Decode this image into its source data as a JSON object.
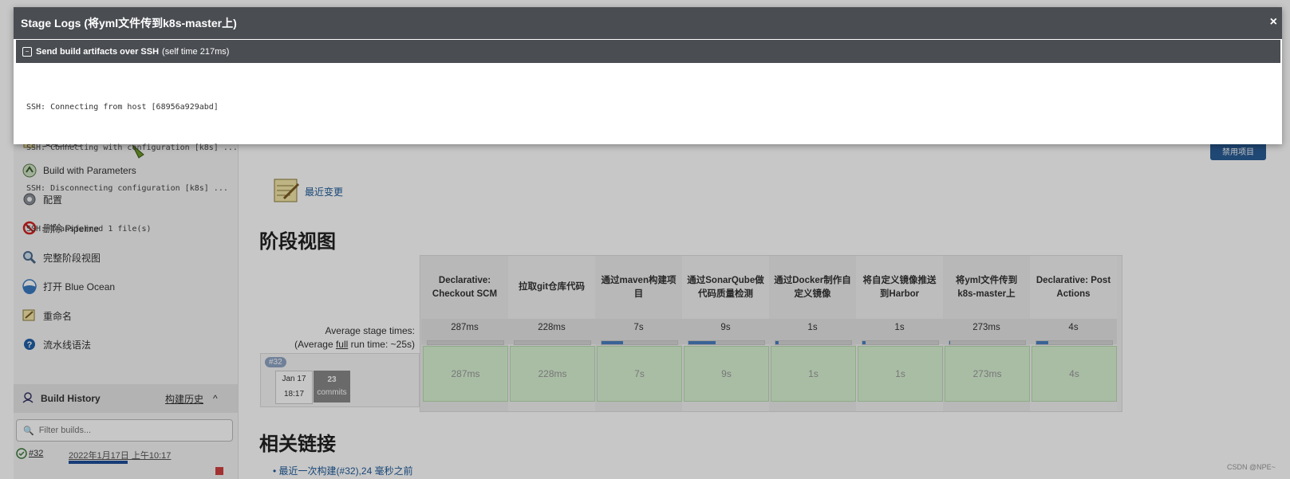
{
  "modal": {
    "title": "Stage Logs (将yml文件传到k8s-master上)",
    "close": "×",
    "step_title": "Send build artifacts over SSH",
    "step_time": "(self time 217ms)",
    "log_lines": [
      "SSH: Connecting from host [68956a929abd]",
      "SSH: Connecting with configuration [k8s] ...",
      "SSH: Disconnecting configuration [k8s] ...",
      "SSH: Transferred 1 file(s)"
    ]
  },
  "sidebar": {
    "items": [
      {
        "label": "变更历史",
        "icon": "notepad-icon"
      },
      {
        "label": "Build with Parameters",
        "icon": "build-icon"
      },
      {
        "label": "配置",
        "icon": "gear-icon"
      },
      {
        "label": "删除 Pipeline",
        "icon": "no-entry-icon"
      },
      {
        "label": "完整阶段视图",
        "icon": "search-icon"
      },
      {
        "label": "打开 Blue Ocean",
        "icon": "blue-ocean-icon"
      },
      {
        "label": "重命名",
        "icon": "pencil-icon"
      },
      {
        "label": "流水线语法",
        "icon": "help-icon"
      }
    ],
    "build_history": {
      "title": "Build History",
      "link": "构建历史",
      "caret": "^"
    },
    "filter_placeholder": "Filter builds...",
    "build": {
      "number": "#32",
      "date": "2022年1月17日 上午10:17"
    }
  },
  "main": {
    "disable_button": "禁用项目",
    "recent_changes": "最近变更",
    "stage_view_title": "阶段视图",
    "avg_label_line1": "Average stage times:",
    "avg_label_line2_prefix": "(Average ",
    "avg_label_line2_link": "full",
    "avg_label_line2_suffix": " run time: ~25s)",
    "run": {
      "badge": "#32",
      "date": "Jan 17",
      "time": "18:17",
      "commits_count": "23",
      "commits_label": "commits"
    },
    "stages": [
      {
        "name": "Declarative: Checkout SCM",
        "avg": "287ms",
        "cell": "287ms",
        "bar_fraction": 0.0
      },
      {
        "name": "拉取git仓库代码",
        "avg": "228ms",
        "cell": "228ms",
        "bar_fraction": 0.0
      },
      {
        "name": "通过maven构建项目",
        "avg": "7s",
        "cell": "7s",
        "bar_fraction": 0.28
      },
      {
        "name": "通过SonarQube做代码质量检测",
        "avg": "9s",
        "cell": "9s",
        "bar_fraction": 0.36
      },
      {
        "name": "通过Docker制作自定义镜像",
        "avg": "1s",
        "cell": "1s",
        "bar_fraction": 0.04
      },
      {
        "name": "将自定义镜像推送到Harbor",
        "avg": "1s",
        "cell": "1s",
        "bar_fraction": 0.04
      },
      {
        "name": "将yml文件传到k8s-master上",
        "avg": "273ms",
        "cell": "273ms",
        "bar_fraction": 0.01
      },
      {
        "name": "Declarative: Post Actions",
        "avg": "4s",
        "cell": "4s",
        "bar_fraction": 0.16
      }
    ],
    "related_links_title": "相关链接",
    "latest_build_link": "最近一次构建(#32),24 毫秒之前"
  },
  "watermark": "CSDN @NPE~"
}
